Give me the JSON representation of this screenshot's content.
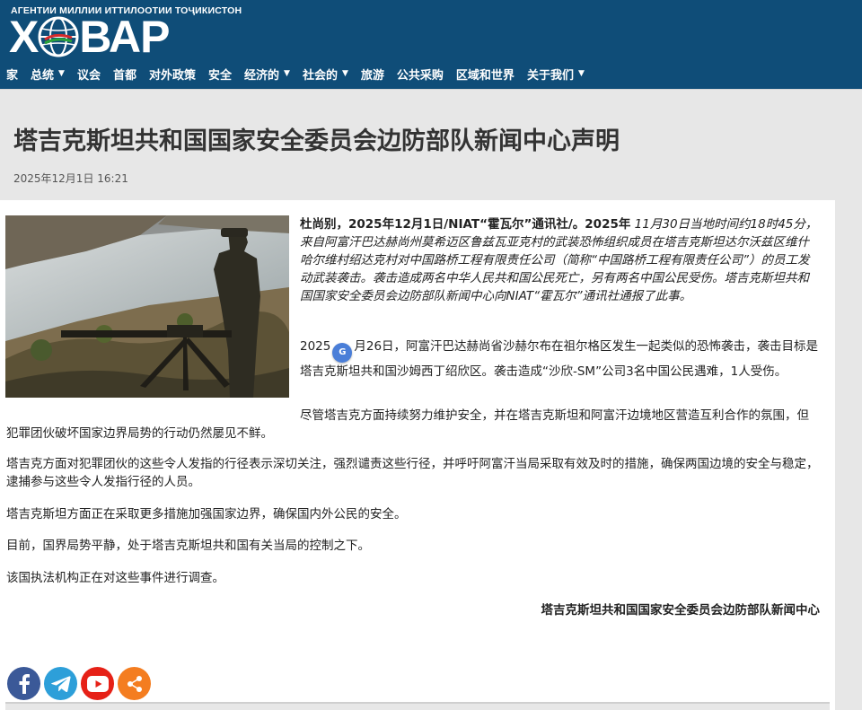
{
  "header": {
    "agency_line": "АГЕНТИИ МИЛЛИИ ИТТИЛООТИИ ТОҶИКИСТОН",
    "logo_left": "Х",
    "logo_right": "ВАР",
    "nav": [
      {
        "label": "家",
        "dropdown": false
      },
      {
        "label": "总统",
        "dropdown": true
      },
      {
        "label": "议会",
        "dropdown": false
      },
      {
        "label": "首都",
        "dropdown": false
      },
      {
        "label": "对外政策",
        "dropdown": false
      },
      {
        "label": "安全",
        "dropdown": false
      },
      {
        "label": "经济的",
        "dropdown": true
      },
      {
        "label": "社会的",
        "dropdown": true
      },
      {
        "label": "旅游",
        "dropdown": false
      },
      {
        "label": "公共采购",
        "dropdown": false
      },
      {
        "label": "区域和世界",
        "dropdown": false
      },
      {
        "label": "关于我们",
        "dropdown": true
      }
    ]
  },
  "article": {
    "title": "塔吉克斯坦共和国国家安全委员会边防部队新闻中心声明",
    "date": "2025年12月1日 16:21",
    "p1_lead": "杜尚别，2025年12月1日/NIAT“霍瓦尔”通讯社/。2025年",
    "p1_body": "11月30日当地时间约18时45分，来自阿富汗巴达赫尚州莫希迈区鲁兹瓦亚克村的武装恐怖组织成员在塔吉克斯坦达尔沃兹区维什哈尔维村绍达克村对中国路桥工程有限责任公司（简称“中国路桥工程有限责任公司”）的员工发动武装袭击。袭击造成两名中华人民共和国公民死亡，另有两名中国公民受伤。塔吉克斯坦共和国国家安全委员会边防部队新闻中心向NIAT“霍瓦尔”通讯社通报了此事。",
    "p2_a": "2025",
    "p2_badge": "G",
    "p2_b": "月26日，阿富汗巴达赫尚省沙赫尔布在祖尔格区发生一起类似的恐怖袭击，袭击目标是塔吉克斯坦共和国沙姆西丁绍欣区。袭击造成“沙欣-SM”公司3名中国公民遇难，1人受伤。",
    "p3": "尽管塔吉克方面持续努力维护安全，并在塔吉克斯坦和阿富汗边境地区营造互利合作的氛围，但犯罪团伙破坏国家边界局势的行动仍然屡见不鲜。",
    "p4": "塔吉克方面对犯罪团伙的这些令人发指的行径表示深切关注，强烈谴责这些行径，并呼吁阿富汗当局采取有效及时的措施，确保两国边境的安全与稳定，逮捕参与这些令人发指行径的人员。",
    "p5": "塔吉克斯坦方面正在采取更多措施加强国家边界，确保国内外公民的安全。",
    "p6": "目前，国界局势平静，处于塔吉克斯坦共和国有关当局的控制之下。",
    "p7": "该国执法机构正在对这些事件进行调查。",
    "signature": "塔吉克斯坦共和国国家安全委员会边防部队新闻中心"
  },
  "share": [
    {
      "icon": "facebook-icon",
      "color": "#3b5998"
    },
    {
      "icon": "telegram-icon",
      "color": "#2d9fd9"
    },
    {
      "icon": "youtube-icon",
      "color": "#e62117"
    },
    {
      "icon": "share-icon",
      "color": "#f47d20"
    }
  ],
  "colors": {
    "header": "#0f4d78",
    "band": "#e7e7e7"
  }
}
